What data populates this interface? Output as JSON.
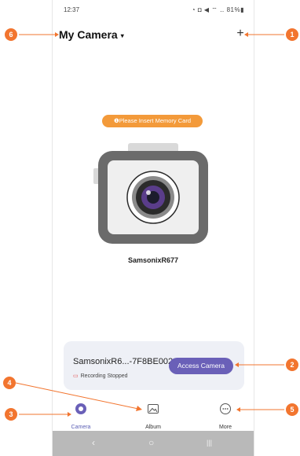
{
  "status_bar": {
    "time": "12:37",
    "icons": "◔ ◘ ◀ ⌔ ‥ 81%▮"
  },
  "header": {
    "title": "My Camera",
    "caret": "▾",
    "add_label": "+"
  },
  "memory_notice": "❶Please Insert Memory Card",
  "device": {
    "name": "SamsonixR677"
  },
  "card": {
    "device_label": "SamsonixR6...-7F8BE002",
    "status": "Recording Stopped",
    "access_button": "Access Camera"
  },
  "nav": {
    "items": [
      {
        "label": "Camera",
        "icon": "camera-icon"
      },
      {
        "label": "Album",
        "icon": "album-icon"
      },
      {
        "label": "More",
        "icon": "more-icon"
      }
    ]
  },
  "system_nav": {
    "back": "‹",
    "home": "○",
    "recent": "|||"
  },
  "annotations": [
    "1",
    "2",
    "3",
    "4",
    "5",
    "6"
  ],
  "colors": {
    "accent_orange": "#f2752f",
    "pill_orange": "#f39a3a",
    "button_purple": "#6a60b8",
    "card_bg": "#eef0f6",
    "camera_body": "#6b6b6b"
  }
}
